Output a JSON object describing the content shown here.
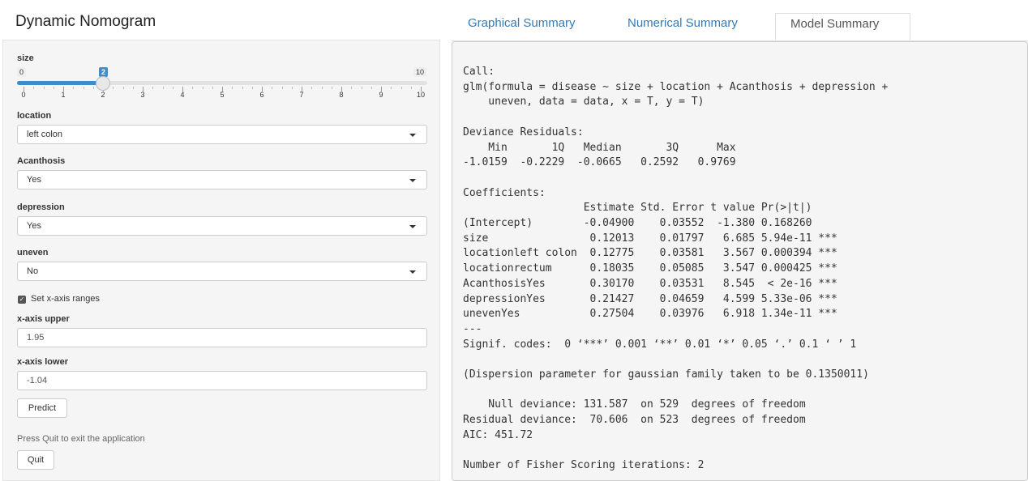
{
  "app": {
    "title": "Dynamic Nomogram"
  },
  "sidebar": {
    "size": {
      "label": "size",
      "min_label": "0",
      "max_label": "10",
      "current_label": "2",
      "value": 2,
      "min": 0,
      "max": 10,
      "tick_labels": [
        "0",
        "1",
        "2",
        "3",
        "4",
        "5",
        "6",
        "7",
        "8",
        "9",
        "10"
      ]
    },
    "location": {
      "label": "location",
      "value": "left colon"
    },
    "acanthosis": {
      "label": "Acanthosis",
      "value": "Yes"
    },
    "depression": {
      "label": "depression",
      "value": "Yes"
    },
    "uneven": {
      "label": "uneven",
      "value": "No"
    },
    "set_ranges": {
      "label": "Set x-axis ranges",
      "checked": true
    },
    "x_upper": {
      "label": "x-axis upper",
      "value": "1.95"
    },
    "x_lower": {
      "label": "x-axis lower",
      "value": "-1.04"
    },
    "predict_label": "Predict",
    "help_text": "Press Quit to exit the application",
    "quit_label": "Quit"
  },
  "tabs": [
    {
      "label": "Graphical Summary",
      "active": false
    },
    {
      "label": "Numerical Summary",
      "active": false
    },
    {
      "label": "Model Summary",
      "active": true
    }
  ],
  "model_summary": {
    "lines": [
      "Call:",
      "glm(formula = disease ~ size + location + Acanthosis + depression +",
      "    uneven, data = data, x = T, y = T)",
      "",
      "Deviance Residuals:",
      "    Min       1Q   Median       3Q      Max",
      "-1.0159  -0.2229  -0.0665   0.2592   0.9769",
      "",
      "Coefficients:",
      "                   Estimate Std. Error t value Pr(>|t|)",
      "(Intercept)        -0.04900    0.03552  -1.380 0.168260",
      "size                0.12013    0.01797   6.685 5.94e-11 ***",
      "locationleft colon  0.12775    0.03581   3.567 0.000394 ***",
      "locationrectum      0.18035    0.05085   3.547 0.000425 ***",
      "AcanthosisYes       0.30170    0.03531   8.545  < 2e-16 ***",
      "depressionYes       0.21427    0.04659   4.599 5.33e-06 ***",
      "unevenYes           0.27504    0.03976   6.918 1.34e-11 ***",
      "---",
      "Signif. codes:  0 ‘***’ 0.001 ‘**’ 0.01 ‘*’ 0.05 ‘.’ 0.1 ‘ ’ 1",
      "",
      "(Dispersion parameter for gaussian family taken to be 0.1350011)",
      "",
      "    Null deviance: 131.587  on 529  degrees of freedom",
      "Residual deviance:  70.606  on 523  degrees of freedom",
      "AIC: 451.72",
      "",
      "Number of Fisher Scoring iterations: 2"
    ]
  }
}
